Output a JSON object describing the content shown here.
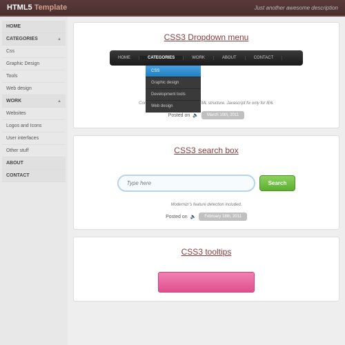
{
  "header": {
    "logo1": "HTML5",
    "logo2": "Template",
    "tagline": "Just another awesome description"
  },
  "sidebar": {
    "items": [
      {
        "label": "HOME",
        "head": true
      },
      {
        "label": "CATEGORIES",
        "head": true,
        "arrow": "▲"
      },
      {
        "label": "Css"
      },
      {
        "label": "Graphic Design"
      },
      {
        "label": "Tools"
      },
      {
        "label": "Web design"
      },
      {
        "label": "WORK",
        "head": true,
        "arrow": "▲"
      },
      {
        "label": "Websites"
      },
      {
        "label": "Logos and Icons"
      },
      {
        "label": "User interfaces"
      },
      {
        "label": "Other stuff"
      },
      {
        "label": "ABOUT",
        "head": true
      },
      {
        "label": "CONTACT",
        "head": true
      }
    ]
  },
  "cards": [
    {
      "title": "CSS3 Dropdown menu",
      "menu": [
        "HOME",
        "CATEGORIES",
        "WORK",
        "ABOUT",
        "CONTACT"
      ],
      "submenu": [
        "CSS",
        "Graphic design",
        "Development tools",
        "Web design"
      ],
      "desc": "Contains clean and accessible HTML structure. Javascript fix only for IE6.",
      "posted": "Posted on",
      "date": "March 10th, 2011"
    },
    {
      "title": "CSS3 search box",
      "placeholder": "Type here",
      "button": "Search",
      "desc": "Modernizr's feature detection included.",
      "posted": "Posted on",
      "date": "February 18th, 2011"
    },
    {
      "title": "CSS3 tooltips"
    }
  ]
}
